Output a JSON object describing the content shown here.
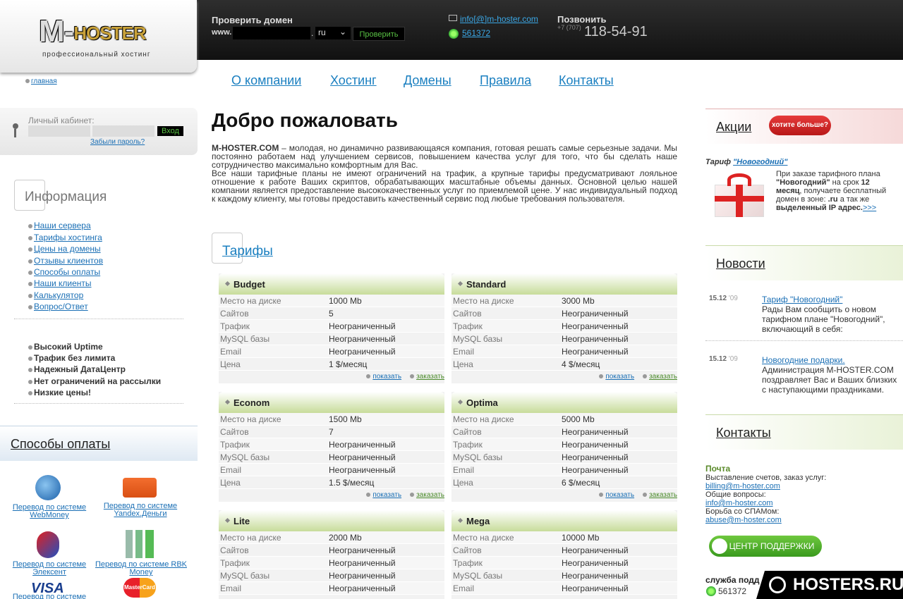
{
  "logo": {
    "main": "M-",
    "accent": "HOSTER",
    "sub": "профессиональный хостинг"
  },
  "domain_check": {
    "label": "Проверить домен",
    "prefix": "www.",
    "zone": "ru",
    "button": "Проверить"
  },
  "contact_top": {
    "email": "info[@]m-hoster.com",
    "icq": "561372"
  },
  "phone": {
    "label": "Позвонить",
    "code": "+7 (707)",
    "number": "118-54-91"
  },
  "nav": {
    "home": "главная",
    "items": [
      "О компании",
      "Хостинг",
      "Домены",
      "Правила",
      "Контакты"
    ]
  },
  "login": {
    "label": "Личный кабинет:",
    "button": "Вход",
    "forgot": "Забыли пароль?"
  },
  "info": {
    "title": "Информация",
    "links": [
      "Наши сервера",
      "Тарифы хостинга",
      "Цены на домены",
      "Отзывы клиентов",
      "Способы оплаты",
      "Наши клиенты",
      "Калькулятор",
      "Вопрос/Ответ"
    ],
    "features": [
      "Высокий Uptime",
      "Трафик без лимита",
      "Надежный ДатаЦентр",
      "Нет ограничений на рассылки",
      "Низкие цены!"
    ]
  },
  "payment": {
    "title": "Способы оплаты",
    "methods": [
      "Перевод по системе WebMoney",
      "Перевод по системе Yandex.Деньги",
      "Перевод по системе Элексент",
      "Перевод по системе RBK Money"
    ],
    "cards": [
      "VISA",
      "MasterCard"
    ],
    "partial": "Перевод по системе"
  },
  "welcome": {
    "title": "Добро пожаловать",
    "brand": "M-HOSTER.COM",
    "p1": " – молодая, но динамично развивающаяся компания, готовая решать самые серьезные задачи. Мы постоянно работаем над улучшением сервисов, повышением качества услуг для того, что бы сделать наше сотрудничество максимально комфортным для Вас.",
    "p2": "Все наши тарифные планы не имеют ограничений на трафик, а крупные тарифы предусматривают лояльное отношение к работе Ваших скриптов, обрабатывающих масштабные объемы данных. Основной целью нашей компании является предоставление высококачественных услуг по приемлемой цене. У нас индивидуальный подход к каждому клиенту, мы готовы предоставить качественный сервис под любые требования пользователя."
  },
  "tariffs": {
    "title": "Тарифы",
    "show": "показать",
    "order": "заказать",
    "keys": [
      "Место на диске",
      "Сайтов",
      "Трафик",
      "MySQL базы",
      "Email",
      "Цена"
    ],
    "plans": [
      {
        "name": "Budget",
        "values": [
          "1000 Mb",
          "5",
          "Неограниченный",
          "Неограниченный",
          "Неограниченный",
          "1 $/месяц"
        ]
      },
      {
        "name": "Standard",
        "values": [
          "3000 Mb",
          "Неограниченный",
          "Неограниченный",
          "Неограниченный",
          "Неограниченный",
          "4 $/месяц"
        ]
      },
      {
        "name": "Econom",
        "values": [
          "1500 Mb",
          "7",
          "Неограниченный",
          "Неограниченный",
          "Неограниченный",
          "1.5 $/месяц"
        ]
      },
      {
        "name": "Optima",
        "values": [
          "5000 Mb",
          "Неограниченный",
          "Неограниченный",
          "Неограниченный",
          "Неограниченный",
          "6 $/месяц"
        ]
      },
      {
        "name": "Lite",
        "values": [
          "2000 Mb",
          "Неограниченный",
          "Неограниченный",
          "Неограниченный",
          "Неограниченный"
        ]
      },
      {
        "name": "Mega",
        "values": [
          "10000 Mb",
          "Неограниченный",
          "Неограниченный",
          "Неограниченный",
          "Неограниченный"
        ]
      }
    ]
  },
  "promo": {
    "title": "Акции",
    "badge": "хотите больше?",
    "tariff_prefix": "Тариф ",
    "tariff_name": "\"Новогодний\"",
    "t1": "При заказе тарифного плана ",
    "t2": "\"Новогодний\"",
    "t3": " на срок ",
    "t4": "12 месяц",
    "t5": ", получаете бесплатный домен в зоне: ",
    "t6": ".ru",
    "t7": " а так же ",
    "t8": "выделенный IP адрес.",
    "more": ">>>"
  },
  "news": {
    "title": "Новости",
    "items": [
      {
        "date": "15.12",
        "year": "'09",
        "title": "Тариф \"Новогодний\"",
        "text": "Рады Вам сообщить о новом тарифном плане \"Новогодний\", включающий в себя:"
      },
      {
        "date": "15.12",
        "year": "'09",
        "title": "Новогодние подарки.",
        "text": "Администрация M-HOSTER.COM поздравляет Вас и Ваших близких с наступающими праздниками."
      }
    ]
  },
  "contacts": {
    "title": "Контакты",
    "mail_label": "Почта",
    "billing_label": "Выставление счетов, заказ услуг:",
    "billing": "billing@m-hoster.com",
    "general_label": "Общие вопросы:",
    "general": "info@m-hoster.com",
    "spam_label": "Борьба со СПАМом:",
    "spam": "abuse@m-hoster.com",
    "support_button": "ЦЕНТР ПОДДЕРЖКИ",
    "service_label": "служба подд",
    "icq": "561372"
  },
  "watermark": "HOSTERS.RU",
  "colors": {
    "accent": "#1a7fc0",
    "green": "#c7dc9a",
    "dark": "#1a1a1a"
  }
}
